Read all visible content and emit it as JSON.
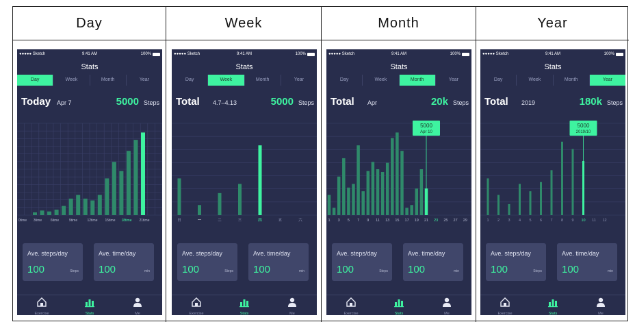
{
  "panels": [
    {
      "key": "day",
      "header": "Day",
      "status": {
        "carrier": "●●●●● Sketch",
        "time": "9:41 AM",
        "battery": "100%"
      },
      "title": "Stats",
      "tabs": [
        "Day",
        "Week",
        "Month",
        "Year"
      ],
      "active_tab": 0,
      "summary": {
        "label": "Today",
        "period": "Apr 7",
        "value": "5000",
        "unit": "Steps"
      },
      "cards": [
        {
          "label": "Ave. steps/day",
          "value": "100",
          "unit": "Steps"
        },
        {
          "label": "Ave. time/day",
          "value": "100",
          "unit": "min"
        }
      ],
      "nav": [
        "Exercise",
        "Stats",
        "Me"
      ],
      "nav_active": 1
    },
    {
      "key": "week",
      "header": "Week",
      "status": {
        "carrier": "●●●●● Sketch",
        "time": "9:41 AM",
        "battery": "100%"
      },
      "title": "Stats",
      "tabs": [
        "Day",
        "Week",
        "Month",
        "Year"
      ],
      "active_tab": 1,
      "summary": {
        "label": "Total",
        "period": "4.7–4.13",
        "value": "5000",
        "unit": "Steps"
      },
      "cards": [
        {
          "label": "Ave. steps/day",
          "value": "100",
          "unit": "Steps"
        },
        {
          "label": "Ave. time/day",
          "value": "100",
          "unit": "min"
        }
      ],
      "nav": [
        "Exercise",
        "Stats",
        "Me"
      ],
      "nav_active": 1
    },
    {
      "key": "month",
      "header": "Month",
      "status": {
        "carrier": "●●●●● Sketch",
        "time": "9:41 AM",
        "battery": "100%"
      },
      "title": "Stats",
      "tabs": [
        "Day",
        "Week",
        "Month",
        "Year"
      ],
      "active_tab": 2,
      "summary": {
        "label": "Total",
        "period": "Apr",
        "value": "20k",
        "unit": "Steps"
      },
      "cards": [
        {
          "label": "Ave. steps/day",
          "value": "100",
          "unit": "Steps"
        },
        {
          "label": "Ave. time/day",
          "value": "100",
          "unit": "min"
        }
      ],
      "nav": [
        "Exercise",
        "Stats",
        "Me"
      ],
      "nav_active": 1
    },
    {
      "key": "year",
      "header": "Year",
      "status": {
        "carrier": "●●●●● Sketch",
        "time": "9:41 AM",
        "battery": "100%"
      },
      "title": "Stats",
      "tabs": [
        "Day",
        "Week",
        "Month",
        "Year"
      ],
      "active_tab": 3,
      "summary": {
        "label": "Total",
        "period": "2019",
        "value": "180k",
        "unit": "Steps"
      },
      "cards": [
        {
          "label": "Ave. steps/day",
          "value": "100",
          "unit": "Steps"
        },
        {
          "label": "Ave. time/day",
          "value": "100",
          "unit": "min"
        }
      ],
      "nav": [
        "Exercise",
        "Stats",
        "Me"
      ],
      "nav_active": 1
    }
  ],
  "colors": {
    "bg": "#282d4c",
    "accent": "#3ef3a0",
    "card": "#40466a",
    "bar_dim": "#2f8a6a"
  },
  "icons": [
    "house-icon",
    "bar-chart-icon",
    "person-icon"
  ],
  "chart_data": [
    {
      "type": "bar",
      "xlabels": [
        "0time",
        "3time",
        "6time",
        "9time",
        "12time",
        "15time",
        "18time",
        "21time"
      ],
      "values": [
        3,
        5,
        4,
        6,
        10,
        18,
        22,
        18,
        16,
        22,
        40,
        58,
        48,
        70,
        82,
        90
      ],
      "highlight_index": 15,
      "highlight_label": "18time",
      "ylim": [
        0,
        100
      ],
      "grid": true
    },
    {
      "type": "bar",
      "categories": [
        "日",
        "一",
        "二",
        "三",
        "四",
        "五",
        "六"
      ],
      "values": [
        40,
        11,
        24,
        34,
        76,
        0,
        0
      ],
      "highlight_index": 4,
      "ylim": [
        0,
        100
      ],
      "grid": true
    },
    {
      "type": "bar",
      "xlabels": [
        "1",
        "3",
        "5",
        "7",
        "9",
        "11",
        "13",
        "15",
        "17",
        "19",
        "21",
        "23",
        "25",
        "27",
        "29"
      ],
      "values": [
        22,
        8,
        42,
        62,
        30,
        34,
        76,
        26,
        48,
        58,
        50,
        47,
        57,
        84,
        90,
        70,
        8,
        11,
        29,
        50,
        29
      ],
      "highlight_index": 20,
      "tooltip": {
        "value": "5000",
        "date": "Apr 10"
      },
      "ylim": [
        0,
        100
      ],
      "grid": true
    },
    {
      "type": "bar",
      "categories": [
        "1",
        "2",
        "3",
        "4",
        "5",
        "6",
        "7",
        "8",
        "9",
        "10",
        "11",
        "12"
      ],
      "values": [
        40,
        22,
        12,
        34,
        26,
        36,
        49,
        80,
        72,
        59,
        0,
        0
      ],
      "highlight_index": 9,
      "tooltip": {
        "value": "5000",
        "date": "2019/10"
      },
      "ylim": [
        0,
        100
      ],
      "grid": true
    }
  ]
}
